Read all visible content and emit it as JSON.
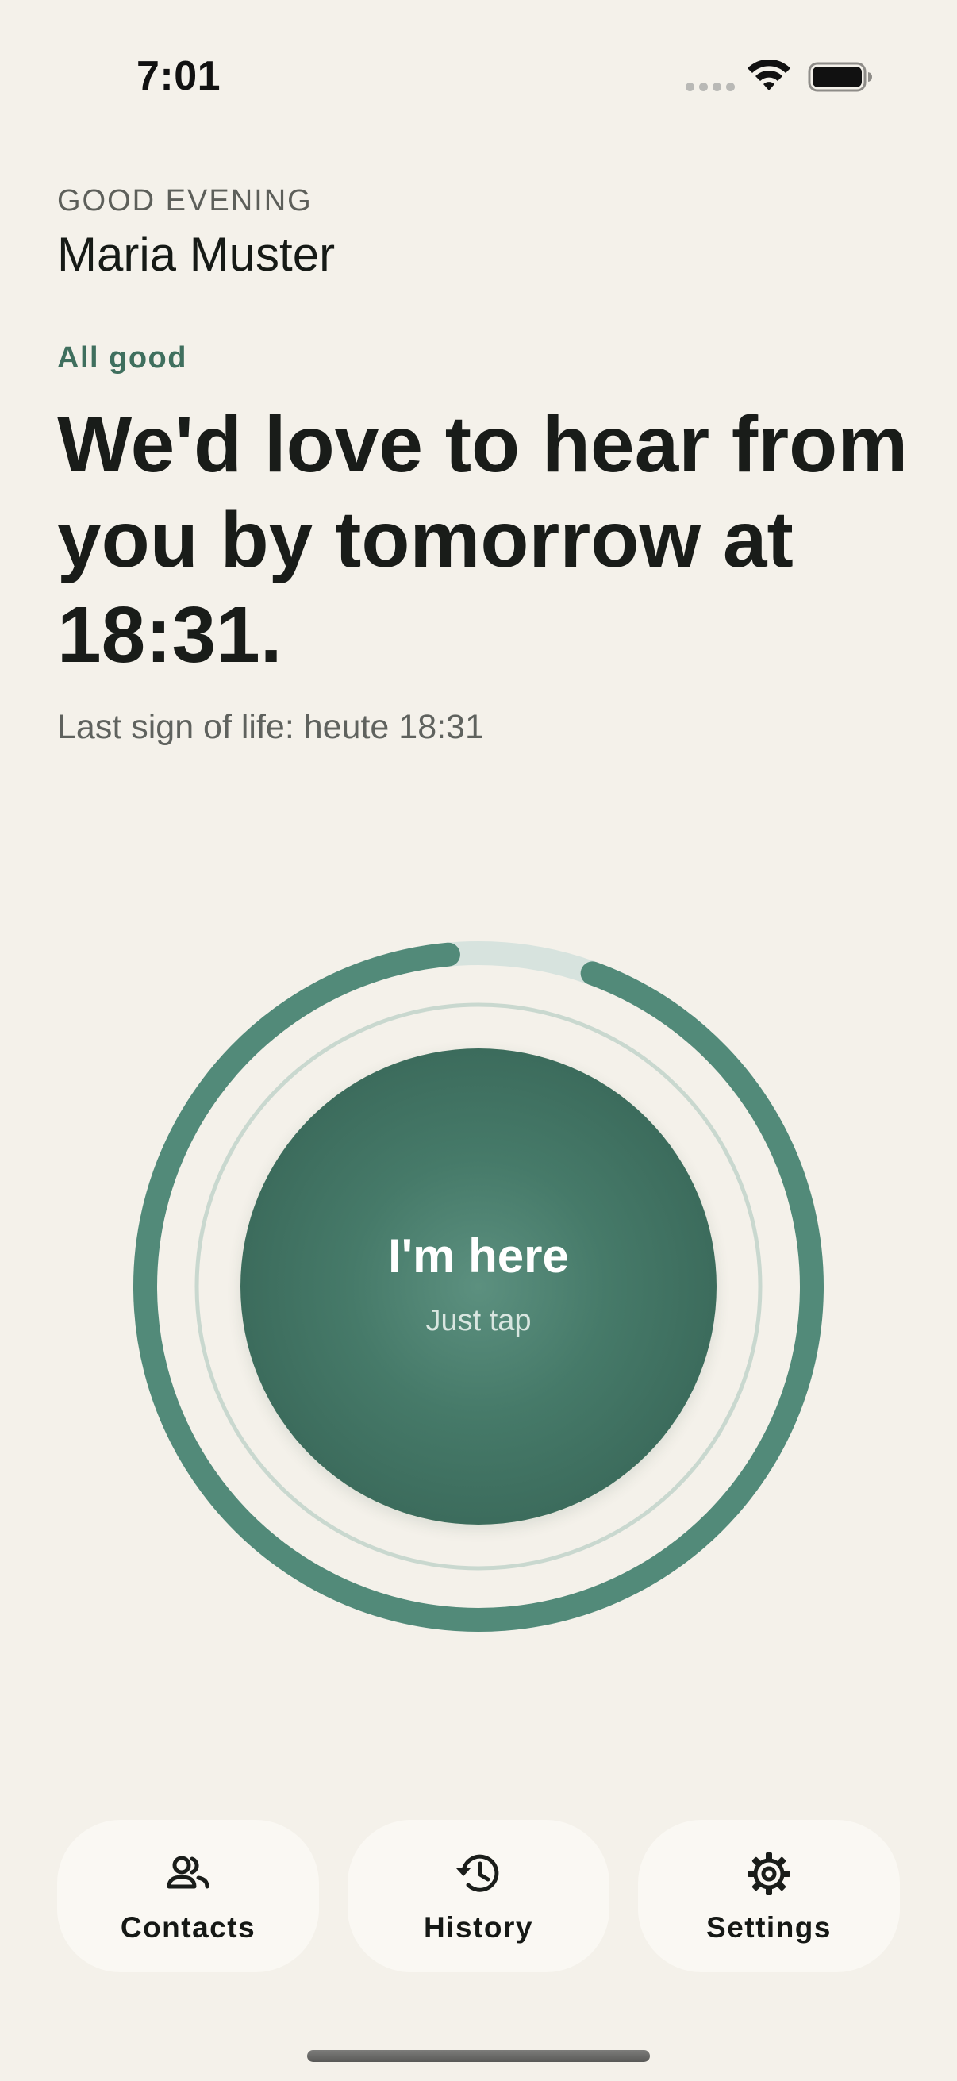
{
  "status_bar": {
    "time": "7:01"
  },
  "header": {
    "greeting": "GOOD EVENING",
    "name": "Maria Muster"
  },
  "status": {
    "label": "All good",
    "headline": "We'd love to hear from you by tomorrow at 18:31.",
    "last_sign": "Last sign of life: heute 18:31"
  },
  "checkin": {
    "title": "I'm here",
    "subtitle": "Just tap",
    "progress_fraction": 0.93
  },
  "nav": {
    "items": [
      {
        "label": "Contacts",
        "icon": "contacts-icon"
      },
      {
        "label": "History",
        "icon": "history-icon"
      },
      {
        "label": "Settings",
        "icon": "settings-icon"
      }
    ]
  },
  "colors": {
    "background": "#f4f1ea",
    "accent": "#4f8a78",
    "accent_dark": "#335f51",
    "nav_button": "#faf8f3",
    "status_label": "#3f6f5e"
  }
}
